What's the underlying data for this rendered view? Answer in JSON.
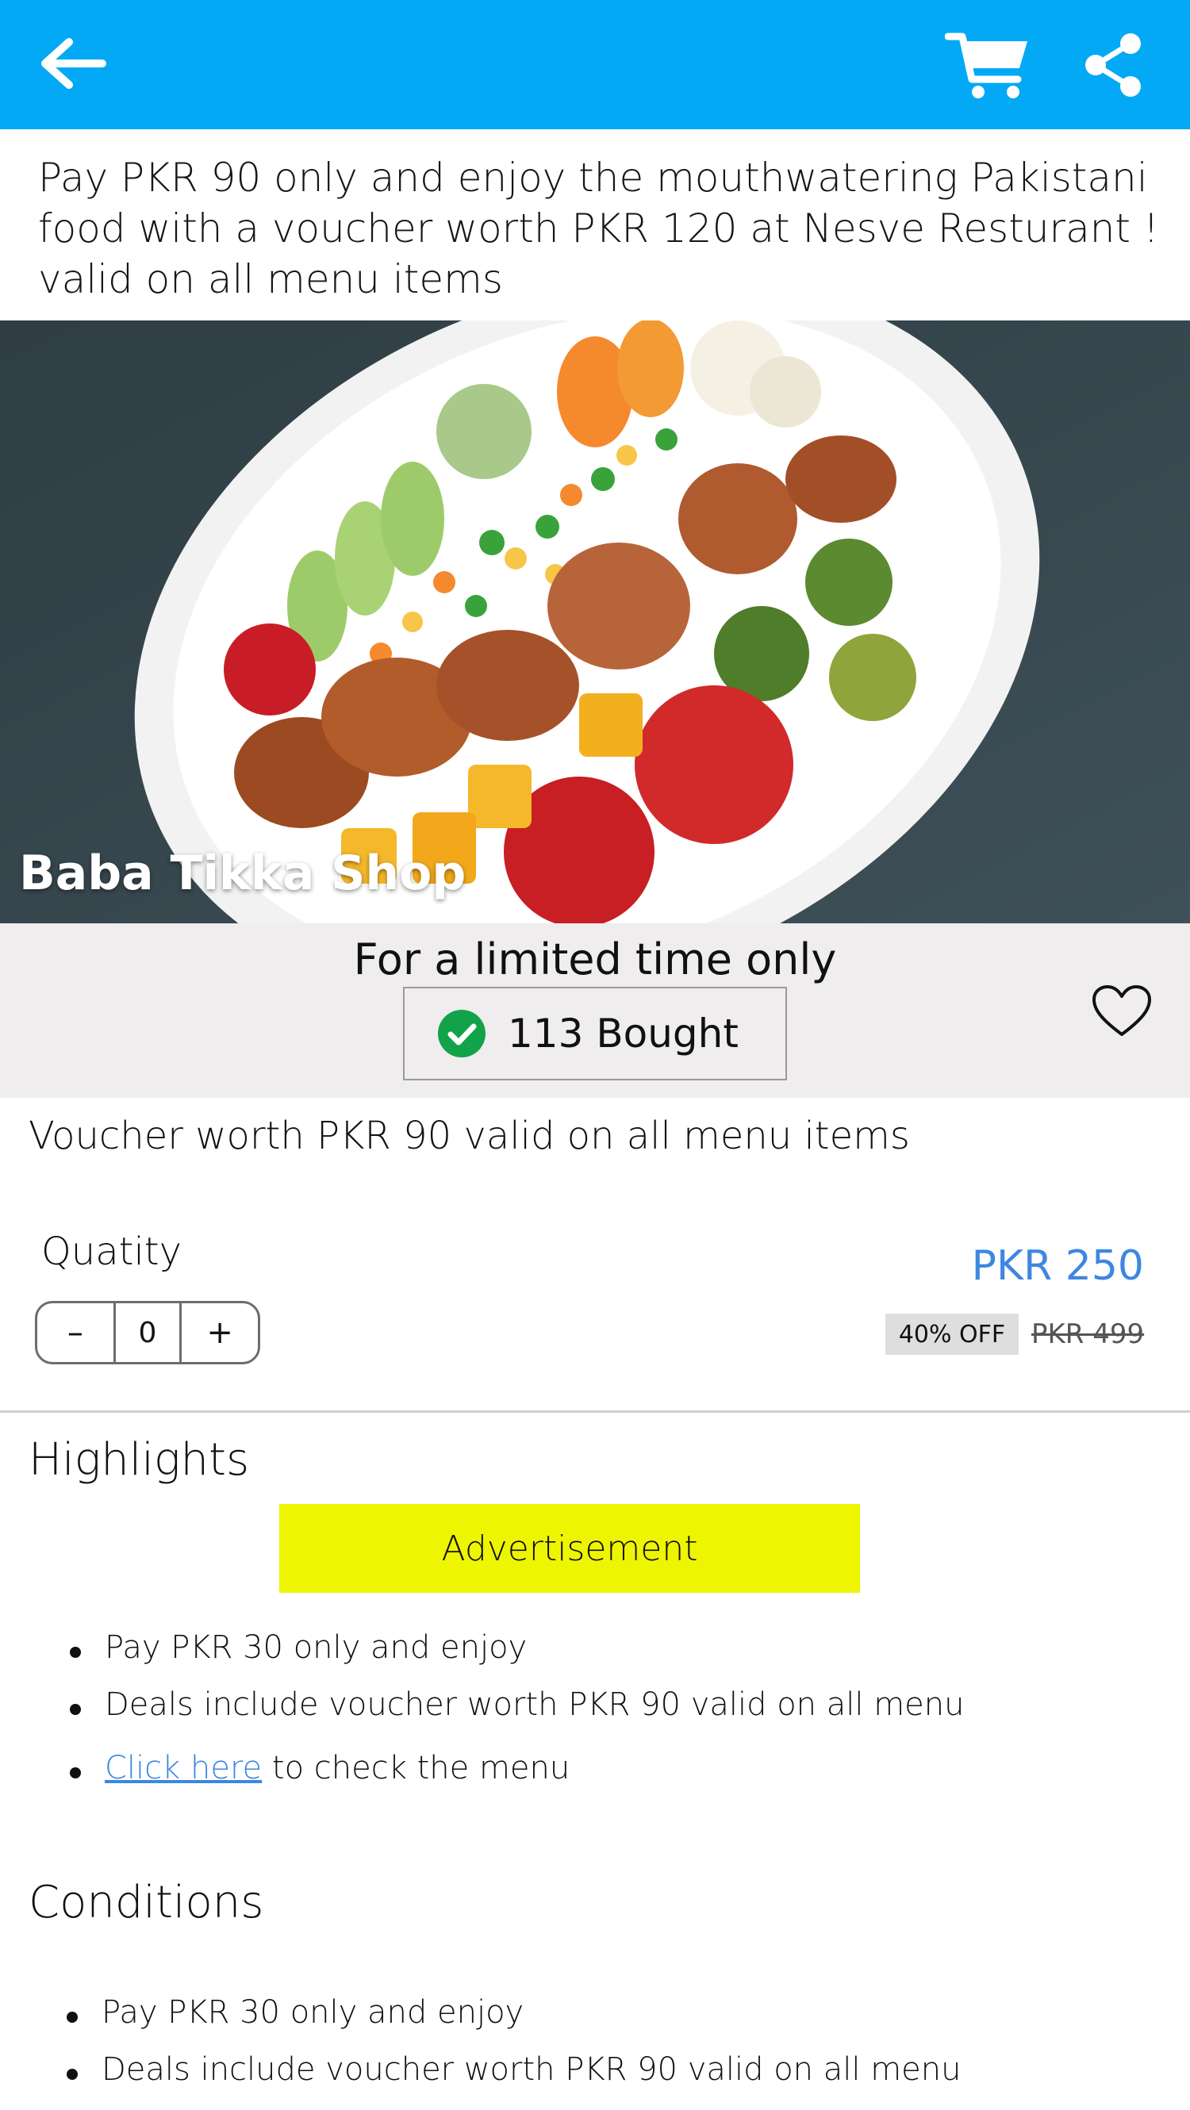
{
  "header": {
    "back_icon": "arrow-left-icon",
    "cart_icon": "shopping-cart-icon",
    "share_icon": "share-icon",
    "color": "#03a9f4"
  },
  "headline": "Pay PKR 90 only and enjoy the mouthwatering Pakistani\nfood with a voucher worth PKR  120 at Nesve Resturant !\nvalid on  all menu items",
  "hero": {
    "shop_name": "Baba Tikka Shop"
  },
  "deal": {
    "limited_text": "For a limited time only",
    "bought_text": "113 Bought",
    "favorite_icon": "heart-outline-icon",
    "check_icon": "check-circle-icon"
  },
  "voucher_line": "Voucher worth PKR 90 valid on all menu items",
  "quantity": {
    "label": "Quatity",
    "minus": "–",
    "value": "0",
    "plus": "+"
  },
  "pricing": {
    "price": "PKR 250",
    "discount": "40% OFF",
    "old_price": "PKR 499",
    "price_color": "#3d87e0"
  },
  "highlights": {
    "title": "Highlights",
    "ad_label": "Advertisement",
    "items": [
      "Pay PKR 30  only and enjoy",
      "Deals include voucher worth PKR 90 valid on all menu"
    ],
    "link_text": "Click here",
    "link_suffix": " to check the menu"
  },
  "conditions": {
    "title": "Conditions",
    "items": [
      "Pay PKR 30  only and enjoy",
      "Deals include voucher worth PKR 90 valid on all menu"
    ]
  }
}
